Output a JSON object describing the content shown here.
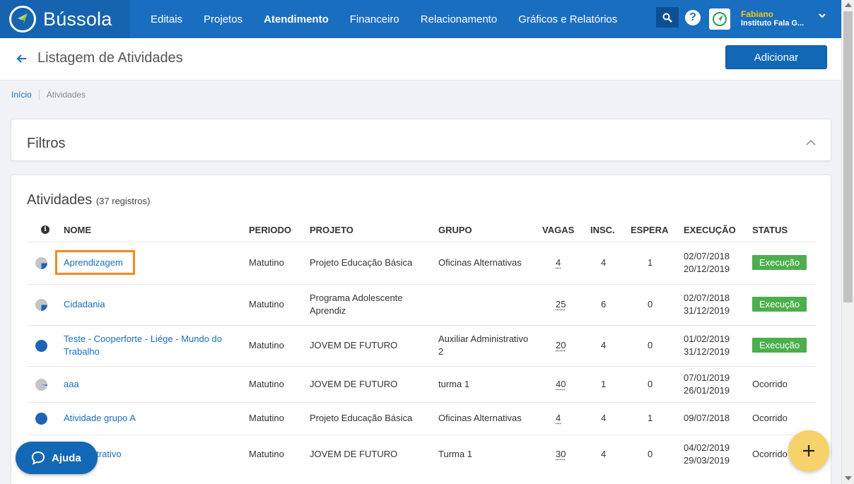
{
  "app": {
    "brand": "Bússola",
    "nav": [
      {
        "label": "Editais",
        "active": false
      },
      {
        "label": "Projetos",
        "active": false
      },
      {
        "label": "Atendimento",
        "active": true
      },
      {
        "label": "Financeiro",
        "active": false
      },
      {
        "label": "Relacionamento",
        "active": false
      },
      {
        "label": "Gráficos e Relatórios",
        "active": false
      }
    ],
    "user": {
      "name": "Fabiano",
      "org": "Instituto Fala G..."
    },
    "colors": {
      "primary": "#1a6ec0",
      "accent": "#f5c518",
      "success": "#4cae4c",
      "highlight": "#f08a24"
    }
  },
  "page": {
    "title": "Listagem de Atividades",
    "add_button": "Adicionar",
    "breadcrumb": {
      "home": "Início",
      "current": "Atividades"
    }
  },
  "filters": {
    "title": "Filtros"
  },
  "activities": {
    "title": "Atividades",
    "count_label": "(37 registros)",
    "columns": {
      "nome": "NOME",
      "periodo": "PERIODO",
      "projeto": "PROJETO",
      "grupo": "GRUPO",
      "vagas": "VAGAS",
      "insc": "INSC.",
      "espera": "ESPERA",
      "execucao": "EXECUÇÃO",
      "status": "STATUS"
    },
    "rows": [
      {
        "nome": "Aprendizagem",
        "periodo": "Matutino",
        "projeto": "Projeto Educação Básica",
        "grupo": "Oficinas Alternativas",
        "vagas": "4",
        "insc": "4",
        "espera": "1",
        "inicio": "02/07/2018",
        "fim": "20/12/2019",
        "status": "Execução",
        "status_badge": true,
        "fill": 0.25,
        "highlighted": true
      },
      {
        "nome": "Cidadania",
        "periodo": "Matutino",
        "projeto": "Programa Adolescente Aprendiz",
        "grupo": "",
        "vagas": "25",
        "insc": "6",
        "espera": "0",
        "inicio": "02/07/2018",
        "fim": "31/12/2019",
        "status": "Execução",
        "status_badge": true,
        "fill": 0.25,
        "highlighted": false
      },
      {
        "nome": "Teste - Cooperforte - Liége - Mundo do Trabalho",
        "periodo": "Matutino",
        "projeto": "JOVEM DE FUTURO",
        "grupo": "Auxiliar Administrativo 2",
        "vagas": "20",
        "insc": "4",
        "espera": "0",
        "inicio": "01/02/2019",
        "fim": "31/12/2019",
        "status": "Execução",
        "status_badge": true,
        "fill": 1,
        "highlighted": false
      },
      {
        "nome": "aaa",
        "periodo": "Matutino",
        "projeto": "JOVEM DE FUTURO",
        "grupo": "turma 1",
        "vagas": "40",
        "insc": "1",
        "espera": "0",
        "inicio": "07/01/2019",
        "fim": "26/01/2019",
        "status": "Ocorrido",
        "status_badge": false,
        "fill": 0.03,
        "highlighted": false
      },
      {
        "nome": "Atividade grupo A",
        "periodo": "Matutino",
        "projeto": "Projeto Educação Básica",
        "grupo": "Oficinas Alternativas",
        "vagas": "4",
        "insc": "4",
        "espera": "1",
        "inicio": "09/07/2018",
        "fim": "",
        "status": "Ocorrido",
        "status_badge": false,
        "fill": 1,
        "highlighted": false
      },
      {
        "nome": "Administrativo",
        "periodo": "Matutino",
        "projeto": "JOVEM DE FUTURO",
        "grupo": "Turma 1",
        "vagas": "30",
        "insc": "4",
        "espera": "0",
        "inicio": "04/02/2019",
        "fim": "29/03/2019",
        "status": "Ocorrido",
        "status_badge": false,
        "fill": 1,
        "highlighted": false
      }
    ]
  },
  "help_button": "Ajuda",
  "plus_button": "+"
}
